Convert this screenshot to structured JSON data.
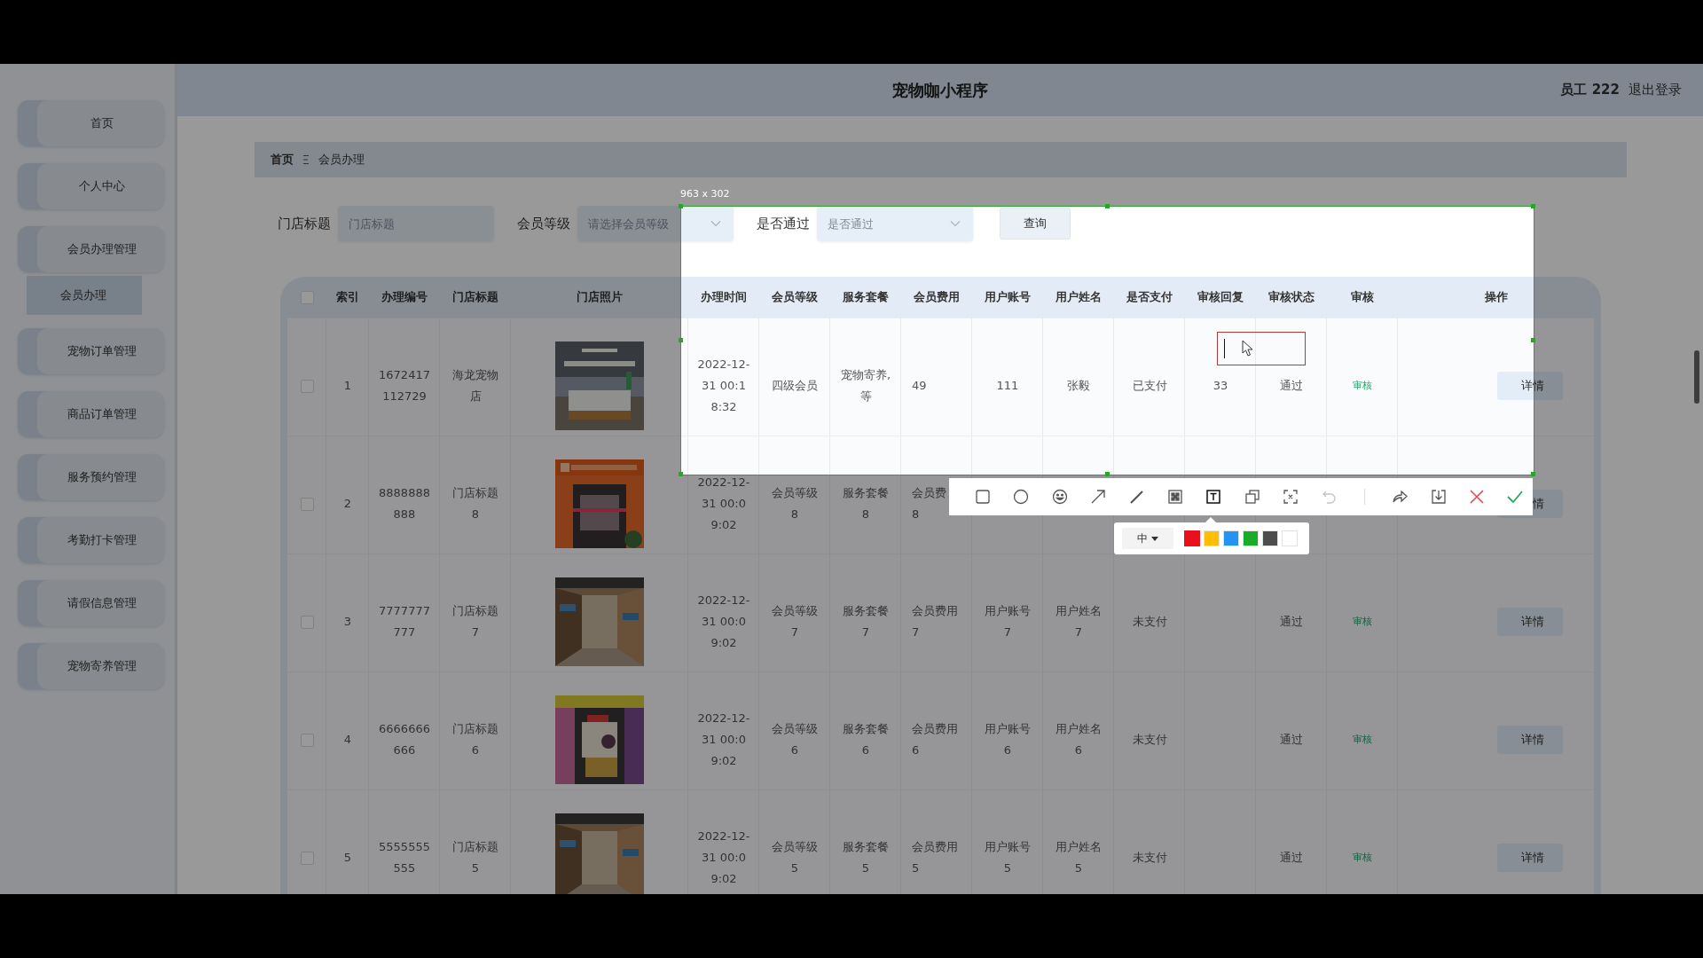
{
  "header": {
    "title": "宠物咖小程序",
    "user": "员工 222",
    "logout": "退出登录"
  },
  "sidebar": {
    "items": [
      {
        "label": "首页",
        "selected": false
      },
      {
        "label": "个人中心",
        "selected": false
      },
      {
        "label": "会员办理管理",
        "selected": false,
        "children": [
          {
            "label": "会员办理",
            "selected": true
          }
        ]
      },
      {
        "label": "宠物订单管理",
        "selected": false
      },
      {
        "label": "商品订单管理",
        "selected": false
      },
      {
        "label": "服务预约管理",
        "selected": false
      },
      {
        "label": "考勤打卡管理",
        "selected": false
      },
      {
        "label": "请假信息管理",
        "selected": false
      },
      {
        "label": "宠物寄养管理",
        "selected": false
      }
    ]
  },
  "breadcrumb": [
    "首页",
    "会员办理"
  ],
  "search": {
    "fields": [
      {
        "label": "门店标题",
        "placeholder": "门店标题",
        "kind": "input"
      },
      {
        "label": "会员等级",
        "placeholder": "请选择会员等级",
        "kind": "select"
      },
      {
        "label": "是否通过",
        "placeholder": "是否通过",
        "kind": "select"
      }
    ],
    "button": "查询"
  },
  "table": {
    "select_all": {
      "checked": false
    },
    "columns": [
      "索引",
      "办理编号",
      "门店标题",
      "门店照片",
      "办理时间",
      "会员等级",
      "服务套餐",
      "会员费用",
      "用户账号",
      "用户姓名",
      "是否支付",
      "审核回复",
      "审核状态",
      "审核",
      "操作"
    ],
    "rows": [
      {
        "checked": false,
        "index": "1",
        "code": "1672417112729",
        "store": "海龙宠物店",
        "time": "2022-12-31 00:18:32",
        "level": "四级会员",
        "package": "宠物寄养,等",
        "fee": "49",
        "account": "111",
        "name": "张毅",
        "paid": "已支付",
        "reply": "33",
        "status": "通过",
        "review": "审核",
        "action": "详情"
      },
      {
        "checked": false,
        "index": "2",
        "code": "8888888888",
        "store": "门店标题8",
        "time": "2022-12-31 00:09:02",
        "level": "会员等级8",
        "package": "服务套餐8",
        "fee": "会员费\n8",
        "action": "情"
      },
      {
        "checked": false,
        "index": "3",
        "code": "7777777777",
        "store": "门店标题7",
        "time": "2022-12-31 00:09:02",
        "level": "会员等级7",
        "package": "服务套餐7",
        "fee": "会员费用7",
        "account": "用户账号7",
        "name": "用户姓名7",
        "paid": "未支付",
        "status": "通过",
        "review": "审核",
        "action": "详情"
      },
      {
        "checked": false,
        "index": "4",
        "code": "6666666666",
        "store": "门店标题6",
        "time": "2022-12-31 00:09:02",
        "level": "会员等级6",
        "package": "服务套餐6",
        "fee": "会员费用6",
        "account": "用户账号6",
        "name": "用户姓名6",
        "paid": "未支付",
        "status": "通过",
        "review": "审核",
        "action": "详情"
      },
      {
        "checked": false,
        "index": "5",
        "code": "5555555555",
        "store": "门店标题5",
        "time": "2022-12-31 00:09:02",
        "level": "会员等级5",
        "package": "服务套餐5",
        "fee": "会员费用5",
        "account": "用户账号5",
        "name": "用户姓名5",
        "paid": "未支付",
        "status": "通过",
        "review": "审核",
        "action": "详情"
      }
    ]
  },
  "screenshot_tool": {
    "size_label": "963 x 302",
    "tools": [
      {
        "kind": "rectangle",
        "selected": false,
        "disabled": false
      },
      {
        "kind": "ellipse",
        "selected": false,
        "disabled": false
      },
      {
        "kind": "emoji",
        "selected": false,
        "disabled": false
      },
      {
        "kind": "arrow",
        "selected": false,
        "disabled": false
      },
      {
        "kind": "pen",
        "selected": false,
        "disabled": false
      },
      {
        "kind": "mosaic",
        "selected": false,
        "disabled": false
      },
      {
        "kind": "text",
        "selected": true,
        "disabled": false
      },
      {
        "kind": "pin",
        "selected": false,
        "disabled": false
      },
      {
        "kind": "ocr",
        "selected": false,
        "disabled": false
      },
      {
        "kind": "undo",
        "selected": false,
        "disabled": true
      }
    ],
    "actions": [
      {
        "kind": "redo"
      },
      {
        "kind": "save"
      },
      {
        "kind": "cancel"
      },
      {
        "kind": "confirm"
      }
    ],
    "palette": {
      "size": "中",
      "colors": [
        {
          "color": "#e8101a",
          "selected": true
        },
        {
          "color": "#ffbf00",
          "selected": false
        },
        {
          "color": "#2294f2",
          "selected": false
        },
        {
          "color": "#1aab29",
          "selected": false
        },
        {
          "color": "#4d4d4d",
          "selected": false
        },
        {
          "color": "#ffffff",
          "selected": false
        }
      ]
    }
  }
}
